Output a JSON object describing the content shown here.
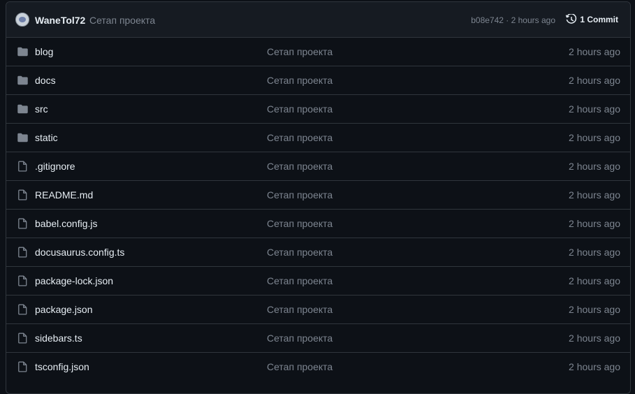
{
  "header": {
    "author": "WaneTol72",
    "commit_message": "Сетап проекта",
    "commit_hash": "b08e742",
    "separator": " · ",
    "commit_time": "2 hours ago",
    "commits_label": "1 Commit"
  },
  "colors": {
    "background": "#0d1117",
    "header_background": "#161b22",
    "border": "#30363d",
    "text": "#e6edf3",
    "muted": "#7d8590",
    "icon": "#7d8590"
  },
  "files": [
    {
      "name": "blog",
      "type": "folder",
      "icon": "folder-icon",
      "message": "Сетап проекта",
      "age": "2 hours ago"
    },
    {
      "name": "docs",
      "type": "folder",
      "icon": "folder-icon",
      "message": "Сетап проекта",
      "age": "2 hours ago"
    },
    {
      "name": "src",
      "type": "folder",
      "icon": "folder-icon",
      "message": "Сетап проекта",
      "age": "2 hours ago"
    },
    {
      "name": "static",
      "type": "folder",
      "icon": "folder-icon",
      "message": "Сетап проекта",
      "age": "2 hours ago"
    },
    {
      "name": ".gitignore",
      "type": "file",
      "icon": "file-icon",
      "message": "Сетап проекта",
      "age": "2 hours ago"
    },
    {
      "name": "README.md",
      "type": "file",
      "icon": "file-icon",
      "message": "Сетап проекта",
      "age": "2 hours ago"
    },
    {
      "name": "babel.config.js",
      "type": "file",
      "icon": "file-icon",
      "message": "Сетап проекта",
      "age": "2 hours ago"
    },
    {
      "name": "docusaurus.config.ts",
      "type": "file",
      "icon": "file-icon",
      "message": "Сетап проекта",
      "age": "2 hours ago"
    },
    {
      "name": "package-lock.json",
      "type": "file",
      "icon": "file-icon",
      "message": "Сетап проекта",
      "age": "2 hours ago"
    },
    {
      "name": "package.json",
      "type": "file",
      "icon": "file-icon",
      "message": "Сетап проекта",
      "age": "2 hours ago"
    },
    {
      "name": "sidebars.ts",
      "type": "file",
      "icon": "file-icon",
      "message": "Сетап проекта",
      "age": "2 hours ago"
    },
    {
      "name": "tsconfig.json",
      "type": "file",
      "icon": "file-icon",
      "message": "Сетап проекта",
      "age": "2 hours ago"
    }
  ]
}
